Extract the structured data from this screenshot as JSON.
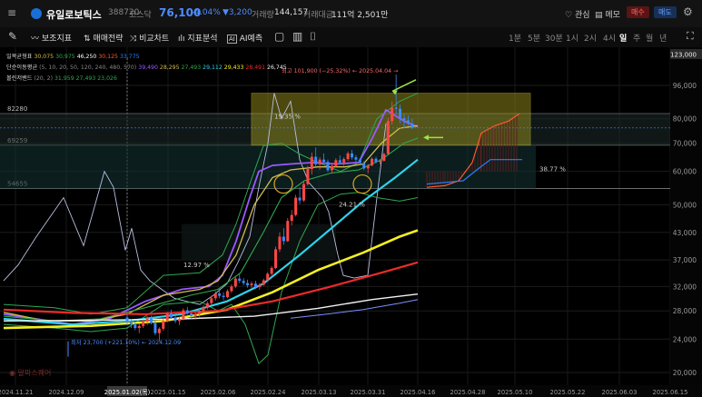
{
  "header": {
    "name": "유일로보틱스",
    "code": "388720",
    "market": "코스닥",
    "price": "76,100",
    "change_pct": "-4.04%",
    "change_amt": "▼3,200",
    "volume_label": "거래량",
    "volume": "144,157",
    "amount_label": "거래대금",
    "amount": "111억 2,501만",
    "watch": "관심",
    "memo": "메모",
    "buy": "매수",
    "sell": "매도",
    "colors": {
      "down": "#4d8cff",
      "buy_bg": "#5a1414",
      "sell_bg": "#173058"
    }
  },
  "toolbar": {
    "tools": [
      "보조지표",
      "매매전략",
      "비교차트",
      "지표분석",
      "AI예측"
    ],
    "periods": [
      "1분",
      "5분",
      "30분",
      "1시",
      "2시",
      "4시",
      "일",
      "주",
      "월",
      "년"
    ],
    "active_period": "일"
  },
  "legend": {
    "ichimoku": {
      "label": "일목균형표",
      "values": [
        "30,075",
        "30,975",
        "46,250",
        "30,125",
        "33,775"
      ]
    },
    "sma": {
      "label": "단순이동평균",
      "params": "(5, 10, 20, 50, 120, 240, 480, 570)",
      "values": [
        "39,490",
        "28,295",
        "27,493",
        "29,112",
        "29,433",
        "28,491",
        "26,745"
      ]
    },
    "bollinger": {
      "label": "볼린저밴드",
      "params": "(20, 2)",
      "values": [
        "31,959",
        "27,493",
        "23,026"
      ]
    }
  },
  "annotations": {
    "high": "최고 101,900 (−25.32%) ← 2025.04.04 →",
    "low": "최저 23,700 (+221.10%) ← 2024.12.09",
    "pct_1935": "19.35 %",
    "pct_3877": "38.77 %",
    "pct_2421": "24.21 %",
    "pct_1297": "12.97 %",
    "level_82280": "82280",
    "level_69259": "69259",
    "level_54655": "54655",
    "watermark": "알파스퀘어"
  },
  "price_box": {
    "price": "76,100",
    "change": "-4.04%",
    "top_value": "123,000"
  },
  "chart_data": {
    "type": "candlestick",
    "y_axis": {
      "scale": "log",
      "ticks": [
        20000,
        24000,
        28000,
        32000,
        37000,
        43000,
        50000,
        60000,
        70000,
        80000,
        96000
      ]
    },
    "x_labels": [
      "2024.11.21",
      "2024.12.09",
      "2025.01.02(목)",
      "2025.01.15",
      "2025.02.06",
      "2025.02.24",
      "2025.03.13",
      "2025.03.31",
      "2025.04.16",
      "2025.05.10",
      "2025.04.28",
      "2025.05.22",
      "2025.06.03",
      "2025.06.15"
    ],
    "candles": [
      [
        27000,
        27600,
        26000,
        26300
      ],
      [
        26300,
        26800,
        25500,
        26000
      ],
      [
        26000,
        26400,
        25200,
        25500
      ],
      [
        25500,
        26100,
        24800,
        25800
      ],
      [
        25800,
        26700,
        25500,
        26400
      ],
      [
        26400,
        27200,
        25900,
        26900
      ],
      [
        26900,
        27300,
        26000,
        26200
      ],
      [
        26200,
        26500,
        24500,
        24800
      ],
      [
        24800,
        25600,
        23700,
        25400
      ],
      [
        25400,
        26800,
        25100,
        26500
      ],
      [
        26500,
        27800,
        26300,
        27600
      ],
      [
        27600,
        28200,
        26800,
        27000
      ],
      [
        27000,
        27400,
        26200,
        26500
      ],
      [
        26500,
        27100,
        25900,
        26800
      ],
      [
        26800,
        28400,
        26600,
        28100
      ],
      [
        28100,
        28600,
        27400,
        27600
      ],
      [
        27600,
        28000,
        26800,
        27200
      ],
      [
        27200,
        27800,
        26700,
        27500
      ],
      [
        27500,
        28300,
        27100,
        28000
      ],
      [
        28000,
        28900,
        27700,
        28500
      ],
      [
        28500,
        29500,
        28200,
        29200
      ],
      [
        29200,
        30400,
        28900,
        30000
      ],
      [
        30000,
        31200,
        29600,
        30800
      ],
      [
        30800,
        31600,
        30000,
        30400
      ],
      [
        30400,
        31000,
        29700,
        30200
      ],
      [
        30200,
        31500,
        30000,
        31200
      ],
      [
        31200,
        32400,
        30900,
        32000
      ],
      [
        32000,
        33800,
        31700,
        33400
      ],
      [
        33400,
        34200,
        32600,
        33000
      ],
      [
        33000,
        33500,
        32200,
        32600
      ],
      [
        32600,
        33200,
        31800,
        32200
      ],
      [
        32200,
        32900,
        31700,
        32500
      ],
      [
        32500,
        33000,
        31600,
        31900
      ],
      [
        31900,
        32600,
        31400,
        32300
      ],
      [
        32300,
        33400,
        32100,
        33100
      ],
      [
        33100,
        34600,
        32900,
        34300
      ],
      [
        34300,
        35800,
        34000,
        35400
      ],
      [
        35400,
        39800,
        35200,
        39200
      ],
      [
        39200,
        43000,
        38600,
        42000
      ],
      [
        42000,
        44000,
        40200,
        41000
      ],
      [
        41000,
        46500,
        40800,
        45800
      ],
      [
        45800,
        48600,
        44700,
        47300
      ],
      [
        47300,
        52800,
        46900,
        52000
      ],
      [
        52000,
        55000,
        50200,
        51200
      ],
      [
        51200,
        56800,
        50800,
        56000
      ],
      [
        56000,
        62000,
        55500,
        60800
      ],
      [
        60800,
        66500,
        59000,
        65000
      ],
      [
        65000,
        68400,
        61500,
        62400
      ],
      [
        62400,
        64800,
        60600,
        64000
      ],
      [
        64000,
        66200,
        62600,
        63200
      ],
      [
        63200,
        64000,
        59800,
        60400
      ],
      [
        60400,
        62600,
        59500,
        61800
      ],
      [
        61800,
        64500,
        61300,
        63800
      ],
      [
        63800,
        65500,
        62500,
        63000
      ],
      [
        63000,
        64800,
        61900,
        64200
      ],
      [
        64200,
        66900,
        63600,
        66200
      ],
      [
        66200,
        67500,
        64000,
        64800
      ],
      [
        64800,
        65600,
        63300,
        64000
      ],
      [
        64000,
        64500,
        62300,
        62800
      ],
      [
        62800,
        63400,
        60400,
        61000
      ],
      [
        61000,
        62500,
        59400,
        62000
      ],
      [
        62000,
        64800,
        61700,
        64300
      ],
      [
        64300,
        65000,
        62700,
        63200
      ],
      [
        63200,
        64200,
        62400,
        63600
      ],
      [
        63600,
        66400,
        63300,
        66000
      ],
      [
        66000,
        80500,
        65800,
        79000
      ],
      [
        79000,
        88000,
        77500,
        85000
      ],
      [
        85000,
        101900,
        82000,
        84500
      ],
      [
        84500,
        86500,
        78000,
        80200
      ],
      [
        80200,
        82000,
        76200,
        79300
      ],
      [
        79300,
        81500,
        77000,
        78000
      ],
      [
        78000,
        80000,
        75600,
        76100
      ]
    ],
    "lines": [
      {
        "name": "5",
        "color": "#9b59ff"
      },
      {
        "name": "10",
        "color": "#d4bd4a"
      },
      {
        "name": "20",
        "color": "#2fa84f"
      },
      {
        "name": "50",
        "color": "#2ed3ec"
      },
      {
        "name": "120",
        "color": "#f4ef22"
      },
      {
        "name": "240",
        "color": "#ee2a2a"
      },
      {
        "name": "480",
        "color": "#f2f2f2"
      },
      {
        "name": "570",
        "color": "#7c8fff"
      }
    ],
    "compare_line_color": "#b8bfe0",
    "cloud_colors": {
      "span_a": "#ff5a2a",
      "span_b": "#2a7fff",
      "fill": "#5a1e1e"
    }
  }
}
